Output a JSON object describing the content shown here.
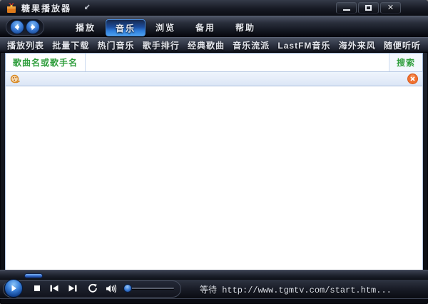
{
  "titlebar": {
    "title": "糖果播放器",
    "icons": {
      "app": "candy-gift-icon",
      "pin": "dock-arrow-icon",
      "minimize": "minimize-icon",
      "maximize": "maximize-icon",
      "close": "close-icon"
    }
  },
  "nav": {
    "back_icon": "back-arrow-icon",
    "forward_icon": "forward-arrow-icon",
    "tabs": [
      {
        "label": "播放",
        "active": false
      },
      {
        "label": "音乐",
        "active": true
      },
      {
        "label": "浏览",
        "active": false
      },
      {
        "label": "备用",
        "active": false
      },
      {
        "label": "帮助",
        "active": false
      }
    ]
  },
  "menu": {
    "items": [
      "播放列表",
      "批量下载",
      "热门音乐",
      "歌手排行",
      "经典歌曲",
      "音乐流派",
      "LastFM音乐",
      "海外来风",
      "随便听听"
    ]
  },
  "search": {
    "label": "歌曲名或歌手名",
    "value": "",
    "button": "搜索"
  },
  "toolstrip": {
    "left_icon": "loading-spinner-icon",
    "right_icon": "close-circle-icon"
  },
  "player": {
    "controls": [
      "play",
      "stop",
      "previous",
      "next",
      "repeat",
      "volume"
    ],
    "status": "等待 http://www.tgmtv.com/start.htm..."
  },
  "colors": {
    "active_tab_blue": "#2f7fdd",
    "search_green": "#2f9e3c",
    "toolstrip_bg": "#dce6f6",
    "close_circle_orange": "#f07030",
    "status_text": "#dde1ea"
  }
}
